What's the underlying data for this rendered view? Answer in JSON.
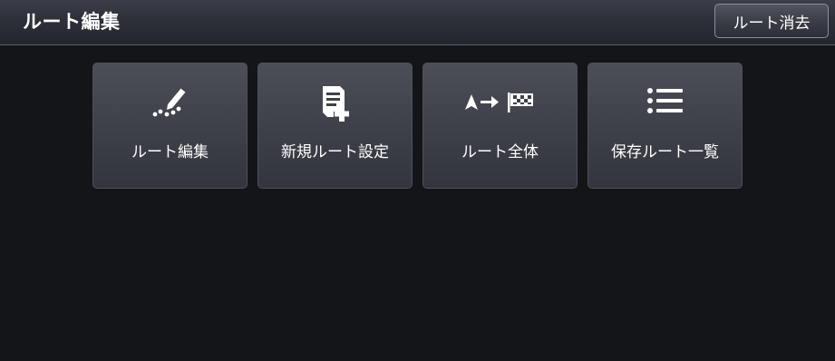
{
  "header": {
    "title": "ルート編集",
    "clear_button_label": "ルート消去"
  },
  "menu": {
    "items": [
      {
        "label": "ルート編集",
        "icon": "pencil-route-icon"
      },
      {
        "label": "新規ルート設定",
        "icon": "new-document-plus-icon"
      },
      {
        "label": "ルート全体",
        "icon": "arrow-to-goal-flag-icon"
      },
      {
        "label": "保存ルート一覧",
        "icon": "list-icon"
      }
    ]
  },
  "colors": {
    "background": "#141519",
    "header": "#2e3039",
    "tile": "#3f414a",
    "text": "#ffffff"
  }
}
